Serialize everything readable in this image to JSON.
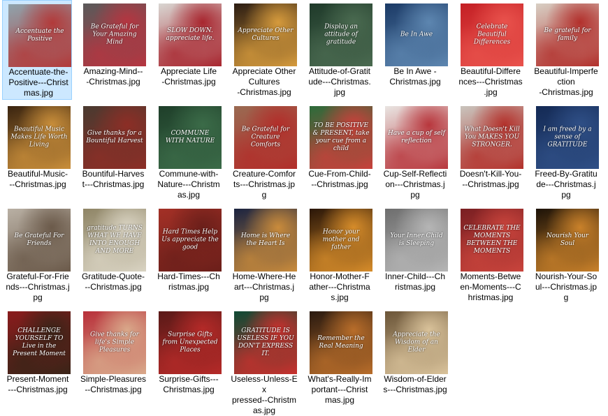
{
  "window": {
    "background": "#ffffff",
    "selection_color": "#cce8ff"
  },
  "files": [
    {
      "name": "Accentuate-the-Positive---Christmas.jpg",
      "label_lines": [
        "Accentuate-the-",
        "Positive---Christ",
        "mas.jpg"
      ],
      "caption": "Accentuate the Positive",
      "colors": [
        "#8fa4ad",
        "#b23a3a"
      ],
      "selected": true
    },
    {
      "name": "Amazing-Mind---Christmas.jpg",
      "label_lines": [
        "Amazing-Mind--",
        "-Christmas.jpg"
      ],
      "caption": "Be Grateful for Your Amazing Mind",
      "colors": [
        "#5a5a5a",
        "#b53540"
      ],
      "selected": false
    },
    {
      "name": "Appreciate Life -Christmas.jpg",
      "label_lines": [
        "Appreciate Life",
        "-Christmas.jpg"
      ],
      "caption": "SLOW DOWN. appreciate life.",
      "colors": [
        "#d9d6d2",
        "#a8262f"
      ],
      "selected": false
    },
    {
      "name": "Appreciate Other Cultures -Christmas.jpg",
      "label_lines": [
        "Appreciate Other",
        "Cultures",
        "-Christmas.jpg"
      ],
      "caption": "Appreciate Other Cultures",
      "colors": [
        "#2b1c12",
        "#d59a3c"
      ],
      "selected": false
    },
    {
      "name": "Attitude-of-Gratitude---Christmas.jpg",
      "label_lines": [
        "Attitude-of-Gratit",
        "ude---Christmas.",
        "jpg"
      ],
      "caption": "Display an attitude of gratitude",
      "colors": [
        "#1f3a2a",
        "#4a6a50"
      ],
      "selected": false
    },
    {
      "name": "Be In Awe -Christmas.jpg",
      "label_lines": [
        "Be In Awe -",
        "Christmas.jpg"
      ],
      "caption": "Be In Awe",
      "colors": [
        "#1b3a66",
        "#5d86b0"
      ],
      "selected": false
    },
    {
      "name": "Beautiful-Differences---Christmas.jpg",
      "label_lines": [
        "Beautiful-Differe",
        "nces---Christmas",
        ".jpg"
      ],
      "caption": "Celebrate Beautiful Differences",
      "colors": [
        "#c42025",
        "#e9524c"
      ],
      "selected": false
    },
    {
      "name": "Beautiful-Imperfection-Christmas.jpg",
      "label_lines": [
        "Beautiful-Imperfe",
        "ction",
        "-Christmas.jpg"
      ],
      "caption": "Be grateful for family",
      "colors": [
        "#d8cfc4",
        "#b2302c"
      ],
      "selected": false
    },
    {
      "name": "Beautiful-Music---Christmas.jpg",
      "label_lines": [
        "Beautiful-Music-",
        "--Christmas.jpg"
      ],
      "caption": "Beautiful Music Makes Life Worth Living",
      "colors": [
        "#3a2410",
        "#c98e3a"
      ],
      "selected": false
    },
    {
      "name": "Bountiful-Harvest---Christmas.jpg",
      "label_lines": [
        "Bountiful-Harves",
        "t---Christmas.jpg"
      ],
      "caption": "Give thanks for a Bountiful Harvest",
      "colors": [
        "#4a3a30",
        "#8c2e26"
      ],
      "selected": false
    },
    {
      "name": "Commune-with-Nature---Christmas.jpg",
      "label_lines": [
        "Commune-with-",
        "Nature---Christm",
        "as.jpg"
      ],
      "caption": "COMMUNE WITH NATURE",
      "colors": [
        "#1f3f2a",
        "#3b6b48"
      ],
      "selected": false
    },
    {
      "name": "Creature-Comforts---Christmas.jpg",
      "label_lines": [
        "Creature-Comfor",
        "ts---Christmas.jp",
        "g"
      ],
      "caption": "Be Grateful for Creature Comforts",
      "colors": [
        "#9a6a52",
        "#b22e2a"
      ],
      "selected": false
    },
    {
      "name": "Cue-From-Child---Christmas.jpg",
      "label_lines": [
        "Cue-From-Child-",
        "--Christmas.jpg"
      ],
      "caption": "TO BE POSITIVE & PRESENT, take your cue from a child",
      "colors": [
        "#2c6b3a",
        "#c8413b"
      ],
      "selected": false
    },
    {
      "name": "Cup-Self-Reflection---Christmas.jpg",
      "label_lines": [
        "Cup-Self-Reflecti",
        "on---Christmas.j",
        "pg"
      ],
      "caption": "Have a cup of self reflection",
      "colors": [
        "#e9e5e2",
        "#b8373d"
      ],
      "selected": false
    },
    {
      "name": "Doesn't-Kill-You---Christmas.jpg",
      "label_lines": [
        "Doesn't-Kill-You-",
        "--Christmas.jpg"
      ],
      "caption": "What Doesn't Kill You MAKES YOU STRONGER.",
      "colors": [
        "#c9c4bd",
        "#b3312b"
      ],
      "selected": false
    },
    {
      "name": "Freed-By-Gratitude---Christmas.jpg",
      "label_lines": [
        "Freed-By-Gratitu",
        "de---Christmas.j",
        "pg"
      ],
      "caption": "I am freed by a sense of GRATITUDE",
      "colors": [
        "#142a55",
        "#2f4f86"
      ],
      "selected": false
    },
    {
      "name": "Grateful-For-Friends---Christmas.jpg",
      "label_lines": [
        "Grateful-For-Frie",
        "nds---Christmas.j",
        "pg"
      ],
      "caption": "Be Grateful For Friends",
      "colors": [
        "#b9b0a4",
        "#6b5a4a"
      ],
      "selected": false
    },
    {
      "name": "Gratitude-Quote---Christmas.jpg",
      "label_lines": [
        "Gratitude-Quote-",
        "--Christmas.jpg"
      ],
      "caption": "gratitude TURNS WHAT WE HAVE INTO ENOUGH AND MORE",
      "colors": [
        "#8f8566",
        "#d9d3c2"
      ],
      "selected": false
    },
    {
      "name": "Hard-Times---Christmas.jpg",
      "label_lines": [
        "Hard-Times---Ch",
        "ristmas.jpg"
      ],
      "caption": "Hard Times Help Us appreciate the good",
      "colors": [
        "#a33026",
        "#6b1f1a"
      ],
      "selected": false
    },
    {
      "name": "Home-Where-Heart---Christmas.jpg",
      "label_lines": [
        "Home-Where-He",
        "art---Christmas.j",
        "pg"
      ],
      "caption": "Home is Where the Heart Is",
      "colors": [
        "#1a2340",
        "#c98b3c"
      ],
      "selected": false
    },
    {
      "name": "Honor-Mother-Father---Christmas.jpg",
      "label_lines": [
        "Honor-Mother-F",
        "ather---Christma",
        "s.jpg"
      ],
      "caption": "Honor your mother and father",
      "colors": [
        "#2a1608",
        "#d68c2a"
      ],
      "selected": false
    },
    {
      "name": "Inner-Child---Christmas.jpg",
      "label_lines": [
        "Inner-Child---Ch",
        "ristmas.jpg"
      ],
      "caption": "Your Inner Child is Sleeping",
      "colors": [
        "#6e6e6e",
        "#b5b5b5"
      ],
      "selected": false
    },
    {
      "name": "Moments-Between-Moments---Christmas.jpg",
      "label_lines": [
        "Moments-Betwe",
        "en-Moments---C",
        "hristmas.jpg"
      ],
      "caption": "CELEBRATE THE MOMENTS BETWEEN THE MOMENTS",
      "colors": [
        "#7a1f22",
        "#c9443c"
      ],
      "selected": false
    },
    {
      "name": "Nourish-Your-Soul---Christmas.jpg",
      "label_lines": [
        "Nourish-Your-So",
        "ul---Christmas.jp",
        "g"
      ],
      "caption": "Nourish Your Soul",
      "colors": [
        "#1c1208",
        "#c9812a"
      ],
      "selected": false
    },
    {
      "name": "Present-Moment---Christmas.jpg",
      "label_lines": [
        "Present-Moment",
        "---Christmas.jpg"
      ],
      "caption": "CHALLENGE YOURSELF TO Live in the Present Moment",
      "colors": [
        "#8a1c1c",
        "#3a2418"
      ],
      "selected": false
    },
    {
      "name": "Simple-Pleasures---Christmas.jpg",
      "label_lines": [
        "Simple-Pleasures",
        "--Christmas.jpg"
      ],
      "caption": "Give thanks for life's Simple Pleasures",
      "colors": [
        "#b8303a",
        "#d9a88a"
      ],
      "selected": false
    },
    {
      "name": "Surprise-Gifts---Christmas.jpg",
      "label_lines": [
        "Surprise-Gifts---",
        "Christmas.jpg"
      ],
      "caption": "Surprise Gifts from Unexpected Places",
      "colors": [
        "#5a1a18",
        "#b52a28"
      ],
      "selected": false
    },
    {
      "name": "Useless-Unless-Expressed--Christmas.jpg",
      "label_lines": [
        "Useless-Unless-Ex",
        "pressed--Christm",
        "as.jpg"
      ],
      "caption": "GRATITUDE IS USELESS IF YOU DON'T EXPRESS IT.",
      "colors": [
        "#0f4a34",
        "#c8302d"
      ],
      "selected": false
    },
    {
      "name": "What's-Really-Important---Christmas.jpg",
      "label_lines": [
        "What's-Really-Im",
        "portant---Christ",
        "mas.jpg"
      ],
      "caption": "Remember the Real Meaning",
      "colors": [
        "#2a1a10",
        "#b86d2a"
      ],
      "selected": false
    },
    {
      "name": "Wisdom-of-Elders---Christmas.jpg",
      "label_lines": [
        "Wisdom-of-Elder",
        "s---Christmas.jpg"
      ],
      "caption": "Appreciate the Wisdom of an Elder",
      "colors": [
        "#6b5538",
        "#d9c29a"
      ],
      "selected": false
    }
  ]
}
